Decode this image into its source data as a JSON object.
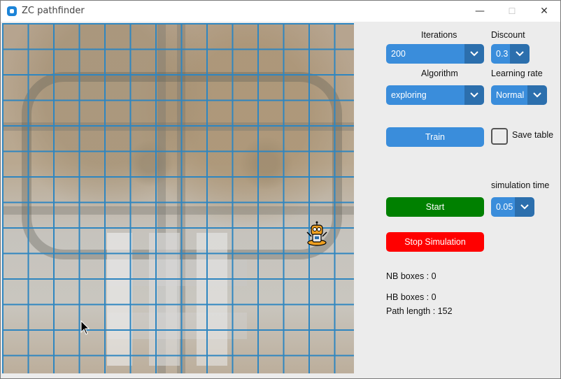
{
  "window": {
    "title": "ZC pathfinder",
    "minimize_glyph": "—",
    "maximize_glyph": "☐",
    "close_glyph": "✕"
  },
  "controls": {
    "iterations_label": "Iterations",
    "iterations_value": "200",
    "discount_label": "Discount",
    "discount_value": "0.3",
    "algorithm_label": "Algorithm",
    "algorithm_value": "exploring",
    "learning_rate_label": "Learning rate",
    "learning_rate_value": "Normal",
    "train_label": "Train",
    "save_table_label": "Save table",
    "simulation_time_label": "simulation time",
    "start_label": "Start",
    "simulation_time_value": "0.05",
    "stop_label": "Stop Simulation"
  },
  "stats": {
    "nb_boxes": "NB boxes : 0",
    "hb_boxes": "HB boxes : 0",
    "path_length": "Path length : 152"
  },
  "colors": {
    "accent": "#3a8ddb",
    "accent_dark": "#2c6fad",
    "start": "#008000",
    "stop": "#ff0000",
    "grid_line": "#2f86c0"
  },
  "icons": {
    "app": "app-icon",
    "robot": "robot-icon",
    "cursor": "mouse-cursor-icon",
    "dropdown_arrow": "chevron-down-icon"
  }
}
